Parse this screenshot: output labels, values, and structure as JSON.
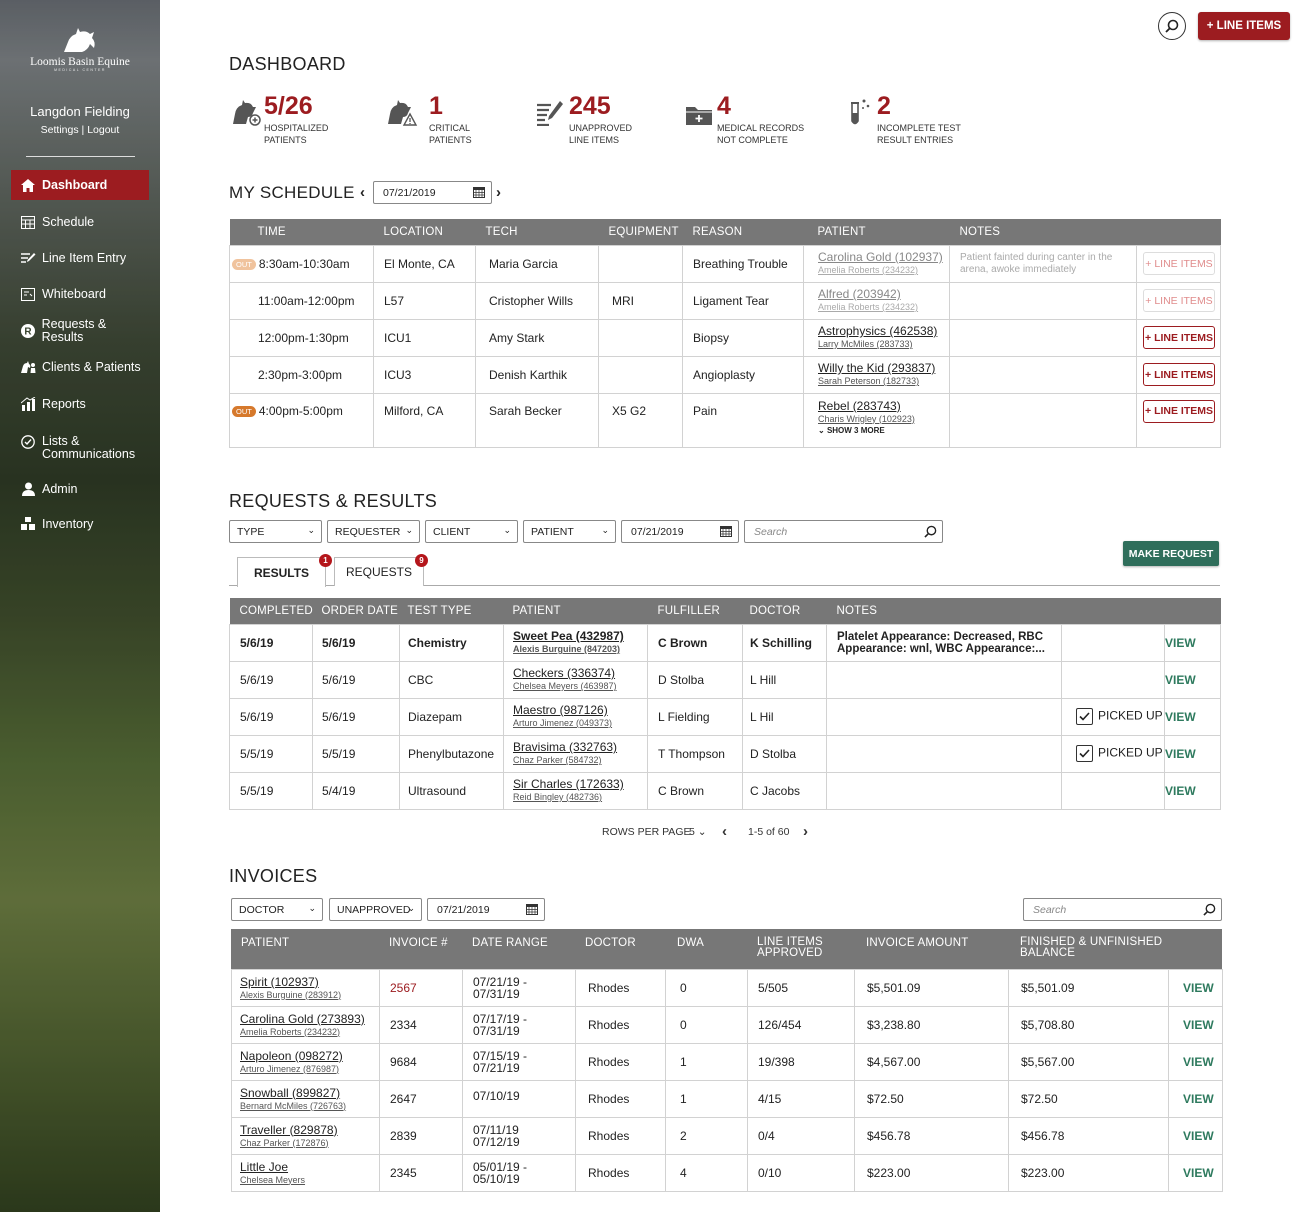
{
  "sidebar": {
    "logo_text": "Loomis Basin Equine",
    "logo_sub": "MEDICAL CENTER",
    "user_name": "Langdon Fielding",
    "settings": "Settings",
    "sep": "|",
    "logout": "Logout",
    "items": [
      {
        "label": "Dashboard",
        "icon": "home-icon",
        "active": true
      },
      {
        "label": "Schedule",
        "icon": "calendar-icon"
      },
      {
        "label": "Line Item Entry",
        "icon": "edit-list-icon"
      },
      {
        "label": "Whiteboard",
        "icon": "whiteboard-icon"
      },
      {
        "label": "Requests & Results",
        "icon": "r-badge-icon"
      },
      {
        "label": "Clients & Patients",
        "icon": "horse-person-icon"
      },
      {
        "label": "Reports",
        "icon": "chart-icon"
      },
      {
        "label": "Lists &",
        "label2": "Communications",
        "icon": "check-circle-icon"
      },
      {
        "label": "Admin",
        "icon": "person-icon"
      },
      {
        "label": "Inventory",
        "icon": "boxes-icon"
      }
    ]
  },
  "header": {
    "line_items_button": "+ LINE ITEMS"
  },
  "dashboard": {
    "title": "DASHBOARD",
    "stats": [
      {
        "value": "5/26",
        "l1": "HOSPITALIZED",
        "l2": "PATIENTS",
        "icon": "horse-plus-icon"
      },
      {
        "value": "1",
        "l1": "CRITICAL",
        "l2": "PATIENTS",
        "icon": "horse-alert-icon"
      },
      {
        "value": "245",
        "l1": "UNAPPROVED",
        "l2": "LINE ITEMS",
        "icon": "pen-list-icon"
      },
      {
        "value": "4",
        "l1": "MEDICAL RECORDS",
        "l2": "NOT COMPLETE",
        "icon": "folder-plus-icon"
      },
      {
        "value": "2",
        "l1": "INCOMPLETE TEST",
        "l2": "RESULT ENTRIES",
        "icon": "test-tube-icon"
      }
    ]
  },
  "schedule": {
    "title": "MY SCHEDULE",
    "date": "07/21/2019",
    "columns": [
      "TIME",
      "LOCATION",
      "TECH",
      "EQUIPMENT",
      "REASON",
      "PATIENT",
      "NOTES",
      ""
    ],
    "rows": [
      {
        "out": "OUT",
        "time": "8:30am-10:30am",
        "location": "El Monte, CA",
        "tech": "Maria Garcia",
        "equipment": "",
        "reason": "Breathing Trouble",
        "patient": "Carolina Gold (102937)",
        "owner": "Amelia Roberts (234232)",
        "notes": "Patient fainted during canter in the arena, awoke immediately",
        "btn": "+ LINE ITEMS",
        "faded": true
      },
      {
        "out": "",
        "time": "11:00am-12:00pm",
        "location": "L57",
        "tech": "Cristopher Wills",
        "equipment": "MRI",
        "reason": "Ligament Tear",
        "patient": "Alfred (203942)",
        "owner": "Amelia Roberts (234232)",
        "notes": "",
        "btn": "+ LINE ITEMS",
        "faded": true
      },
      {
        "out": "",
        "time": "12:00pm-1:30pm",
        "location": "ICU1",
        "tech": "Amy Stark",
        "equipment": "",
        "reason": "Biopsy",
        "patient": "Astrophysics (462538)",
        "owner": "Larry McMiles (283733)",
        "notes": "",
        "btn": "+ LINE ITEMS"
      },
      {
        "out": "",
        "time": "2:30pm-3:00pm",
        "location": "ICU3",
        "tech": "Denish Karthik",
        "equipment": "",
        "reason": "Angioplasty",
        "patient": "Willy the Kid (293837)",
        "owner": "Sarah Peterson (182733)",
        "notes": "",
        "btn": "+ LINE ITEMS"
      },
      {
        "out": "OUT",
        "time": "4:00pm-5:00pm",
        "location": "Milford, CA",
        "tech": "Sarah Becker",
        "equipment": "X5 G2",
        "reason": "Pain",
        "patient": "Rebel (283743)",
        "owner": "Charis Wrigley (102923)",
        "more": "SHOW 3 MORE",
        "notes": "",
        "btn": "+ LINE ITEMS"
      }
    ]
  },
  "requests": {
    "title": "REQUESTS & RESULTS",
    "filters": [
      "TYPE",
      "REQUESTER",
      "CLIENT",
      "PATIENT"
    ],
    "date": "07/21/2019",
    "search_placeholder": "Search",
    "make_request": "MAKE REQUEST",
    "tabs": [
      {
        "label": "RESULTS",
        "badge": "1"
      },
      {
        "label": "REQUESTS",
        "badge": "9"
      }
    ],
    "columns": [
      "COMPLETED",
      "ORDER DATE",
      "TEST TYPE",
      "PATIENT",
      "FULFILLER",
      "DOCTOR",
      "NOTES",
      "",
      ""
    ],
    "rows": [
      {
        "completed": "5/6/19",
        "order": "5/6/19",
        "test": "Chemistry",
        "patient": "Sweet Pea (432987)",
        "owner": "Alexis Burguine (847203)",
        "fulfiller": "C Brown",
        "doctor": "K Schilling",
        "notes": "Platelet Appearance: Decreased, RBC Appearance: wnl, WBC Appearance:...",
        "picked": "",
        "view": "VIEW",
        "bold": true
      },
      {
        "completed": "5/6/19",
        "order": "5/6/19",
        "test": "CBC",
        "patient": "Checkers (336374)",
        "owner": "Chelsea Meyers (463987)",
        "fulfiller": "D Stolba",
        "doctor": "L Hill",
        "notes": "",
        "picked": "",
        "view": "VIEW"
      },
      {
        "completed": "5/6/19",
        "order": "5/6/19",
        "test": "Diazepam",
        "patient": "Maestro (987126)",
        "owner": "Arturo Jimenez (049373)",
        "fulfiller": "L Fielding",
        "doctor": "L Hil",
        "notes": "",
        "picked": "PICKED UP",
        "view": "VIEW"
      },
      {
        "completed": "5/5/19",
        "order": "5/5/19",
        "test": "Phenylbutazone",
        "patient": "Bravisima (332763)",
        "owner": "Chaz Parker (584732)",
        "fulfiller": "T Thompson",
        "doctor": "D Stolba",
        "notes": "",
        "picked": "PICKED UP",
        "view": "VIEW"
      },
      {
        "completed": "5/5/19",
        "order": "5/4/19",
        "test": "Ultrasound",
        "patient": "Sir Charles (172633)",
        "owner": "Reid Bingley (482736)",
        "fulfiller": "C Brown",
        "doctor": "C Jacobs",
        "notes": "",
        "picked": "",
        "view": "VIEW"
      }
    ],
    "pager": {
      "rows_label": "ROWS PER PAGE",
      "rows_value": "5",
      "range": "1-5 of 60"
    }
  },
  "invoices": {
    "title": "INVOICES",
    "filters": [
      "DOCTOR",
      "UNAPPROVED"
    ],
    "date": "07/21/2019",
    "search_placeholder": "Search",
    "columns": [
      "PATIENT",
      "INVOICE #",
      "DATE RANGE",
      "DOCTOR",
      "DWA",
      "LINE ITEMS APPROVED",
      "INVOICE AMOUNT",
      "FINISHED & UNFINISHED BALANCE",
      ""
    ],
    "rows": [
      {
        "patient": "Spirit (102937)",
        "owner": "Alexis Burguine (283912)",
        "invoice": "2567",
        "d1": "07/21/19 -",
        "d2": "07/31/19",
        "doctor": "Rhodes",
        "dwa": "0",
        "approved": "5/505",
        "amount": "$5,501.09",
        "balance": "$5,501.09",
        "view": "VIEW",
        "red": true
      },
      {
        "patient": "Carolina Gold (273893)",
        "owner": "Amelia Roberts (234232)",
        "invoice": "2334",
        "d1": "07/17/19 -",
        "d2": "07/31/19",
        "doctor": "Rhodes",
        "dwa": "0",
        "approved": "126/454",
        "amount": "$3,238.80",
        "balance": "$5,708.80",
        "view": "VIEW"
      },
      {
        "patient": "Napoleon (098272)",
        "owner": "Arturo Jimenez (876987)",
        "invoice": "9684",
        "d1": "07/15/19 -",
        "d2": "07/21/19",
        "doctor": "Rhodes",
        "dwa": "1",
        "approved": "19/398",
        "amount": "$4,567.00",
        "balance": "$5,567.00",
        "view": "VIEW"
      },
      {
        "patient": "Snowball (899827)",
        "owner": "Bernard McMiles (726763)",
        "invoice": "2647",
        "d1": "07/10/19",
        "d2": "",
        "doctor": "Rhodes",
        "dwa": "1",
        "approved": "4/15",
        "amount": "$72.50",
        "balance": "$72.50",
        "view": "VIEW"
      },
      {
        "patient": "Traveller (829878)",
        "owner": "Chaz Parker (172876)",
        "invoice": "2839",
        "d1": "07/11/19",
        "d2": "07/12/19",
        "doctor": "Rhodes",
        "dwa": "2",
        "approved": "0/4",
        "amount": "$456.78",
        "balance": "$456.78",
        "view": "VIEW"
      },
      {
        "patient": "Little Joe",
        "owner": "Chelsea Meyers",
        "invoice": "2345",
        "d1": "05/01/19 -",
        "d2": "05/10/19",
        "doctor": "Rhodes",
        "dwa": "4",
        "approved": "0/10",
        "amount": "$223.00",
        "balance": "$223.00",
        "view": "VIEW"
      }
    ]
  },
  "colors": {
    "brand_red": "#9c1c20",
    "header_gray": "#777777",
    "view_green": "#2e7a5e",
    "out_orange": "#d6792c"
  }
}
